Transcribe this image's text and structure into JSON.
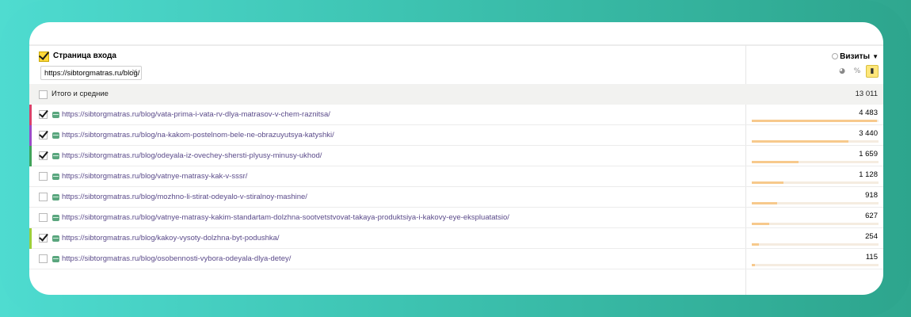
{
  "header": {
    "dimension_title": "Страница входа",
    "filter_value": "https://sibtorgmatras.ru/blog/",
    "metric_label": "Визиты"
  },
  "view_buttons": [
    {
      "icon": "pie-chart-icon",
      "active": false
    },
    {
      "icon": "percent-icon",
      "active": false
    },
    {
      "icon": "bar-chart-icon",
      "active": true
    }
  ],
  "totals": {
    "label": "Итого и средние",
    "value": "13 011"
  },
  "rows": [
    {
      "url": "https://sibtorgmatras.ru/blog/vata-prima-i-vata-rv-dlya-matrasov-v-chem-raznitsa/",
      "visits": "4 483",
      "share": 0.3446,
      "checked": true,
      "color": "#d9426a"
    },
    {
      "url": "https://sibtorgmatras.ru/blog/na-kakom-postelnom-bele-ne-obrazuyutsya-katyshki/",
      "visits": "3 440",
      "share": 0.2644,
      "checked": true,
      "color": "#9a4cc8"
    },
    {
      "url": "https://sibtorgmatras.ru/blog/odeyala-iz-ovechey-shersti-plyusy-minusy-ukhod/",
      "visits": "1 659",
      "share": 0.1275,
      "checked": true,
      "color": "#3fa35a"
    },
    {
      "url": "https://sibtorgmatras.ru/blog/vatnye-matrasy-kak-v-sssr/",
      "visits": "1 128",
      "share": 0.0867,
      "checked": false,
      "color": ""
    },
    {
      "url": "https://sibtorgmatras.ru/blog/mozhno-li-stirat-odeyalo-v-stiralnoy-mashine/",
      "visits": "918",
      "share": 0.0706,
      "checked": false,
      "color": ""
    },
    {
      "url": "https://sibtorgmatras.ru/blog/vatnye-matrasy-kakim-standartam-dolzhna-sootvetstvovat-takaya-produktsiya-i-kakovy-eye-ekspluatatsio/",
      "visits": "627",
      "share": 0.0482,
      "checked": false,
      "color": ""
    },
    {
      "url": "https://sibtorgmatras.ru/blog/kakoy-vysoty-dolzhna-byt-podushka/",
      "visits": "254",
      "share": 0.0195,
      "checked": true,
      "color": "#9ccf3a"
    },
    {
      "url": "https://sibtorgmatras.ru/blog/osobennosti-vybora-odeyala-dlya-detey/",
      "visits": "115",
      "share": 0.0088,
      "checked": false,
      "color": ""
    }
  ]
}
